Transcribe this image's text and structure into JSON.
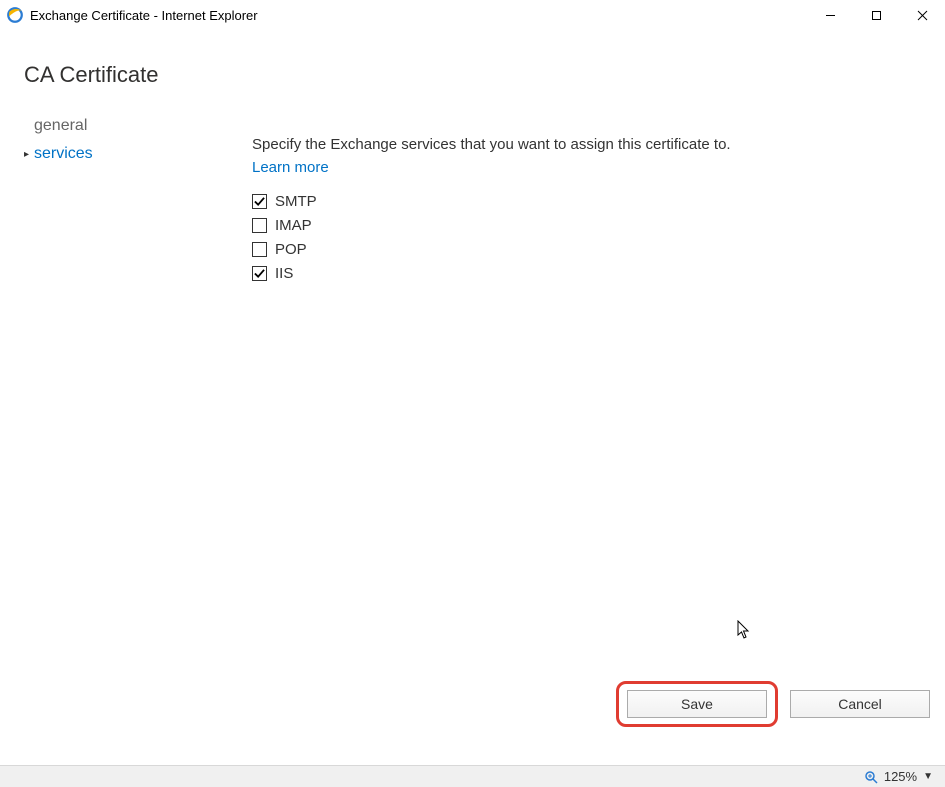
{
  "window": {
    "title": "Exchange Certificate - Internet Explorer"
  },
  "page": {
    "heading": "CA Certificate"
  },
  "sidebar": {
    "items": [
      {
        "label": "general",
        "selected": false
      },
      {
        "label": "services",
        "selected": true
      }
    ]
  },
  "main": {
    "instruction_prefix": "Specify the Exchange services that you want to assign this certificate to. ",
    "learn_more": "Learn more",
    "services": [
      {
        "label": "SMTP",
        "checked": true
      },
      {
        "label": "IMAP",
        "checked": false
      },
      {
        "label": "POP",
        "checked": false
      },
      {
        "label": "IIS",
        "checked": true
      }
    ]
  },
  "buttons": {
    "save": "Save",
    "cancel": "Cancel"
  },
  "status": {
    "zoom": "125%"
  }
}
